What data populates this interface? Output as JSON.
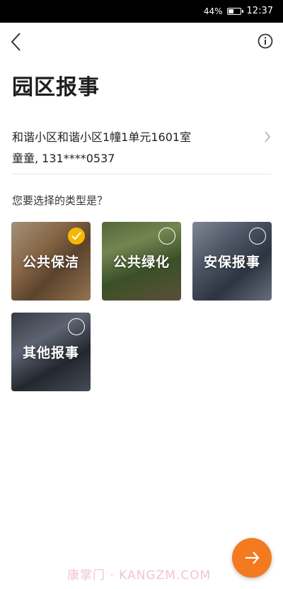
{
  "status_bar": {
    "battery_percent": "44%",
    "battery_level": 0.44,
    "time": "12:37"
  },
  "nav": {
    "back_icon": "chevron-left-icon",
    "info_icon": "info-circle-icon"
  },
  "title": "园区报事",
  "address": {
    "line": "和谐小区和谐小区1幢1单元1601室",
    "contact": "童童, 131****0537",
    "chevron_icon": "chevron-right-icon"
  },
  "question": "您要选择的类型是？",
  "categories": [
    {
      "label": "公共保洁",
      "selected": true
    },
    {
      "label": "公共绿化",
      "selected": false
    },
    {
      "label": "安保报事",
      "selected": false
    },
    {
      "label": "其他报事",
      "selected": false
    }
  ],
  "fab": {
    "icon": "arrow-next-icon"
  },
  "colors": {
    "accent": "#f47a1f",
    "check": "#f5b800"
  },
  "watermark": "康掌门 · KANGZM.COM"
}
